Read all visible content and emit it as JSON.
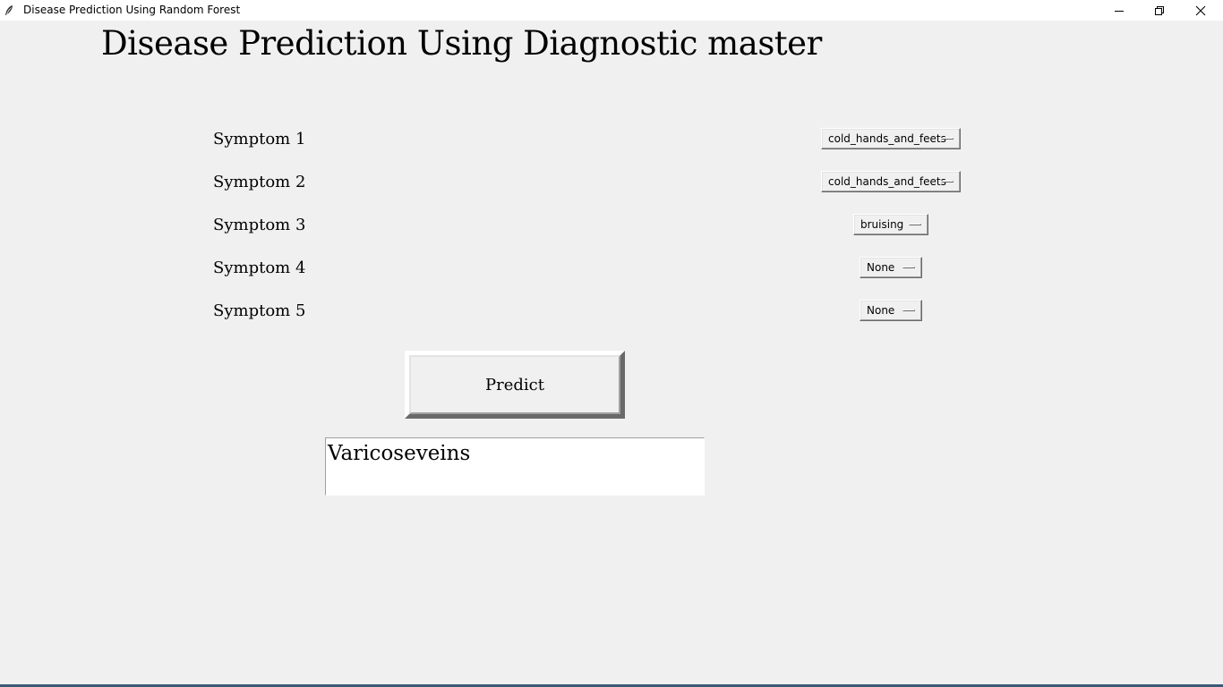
{
  "window": {
    "title": "Disease Prediction Using Random Forest"
  },
  "heading": "Disease Prediction Using Diagnostic master",
  "symptoms": [
    {
      "label": "Symptom 1",
      "value": "cold_hands_and_feets"
    },
    {
      "label": "Symptom 2",
      "value": "cold_hands_and_feets"
    },
    {
      "label": "Symptom 3",
      "value": "bruising"
    },
    {
      "label": "Symptom 4",
      "value": "None"
    },
    {
      "label": "Symptom 5",
      "value": "None"
    }
  ],
  "predict_button": {
    "label": "Predict"
  },
  "result": {
    "text": "Varicoseveins"
  },
  "icons": {
    "app": "feather-icon",
    "minimize": "minimize-icon",
    "maximize": "restore-icon",
    "close": "close-icon"
  }
}
